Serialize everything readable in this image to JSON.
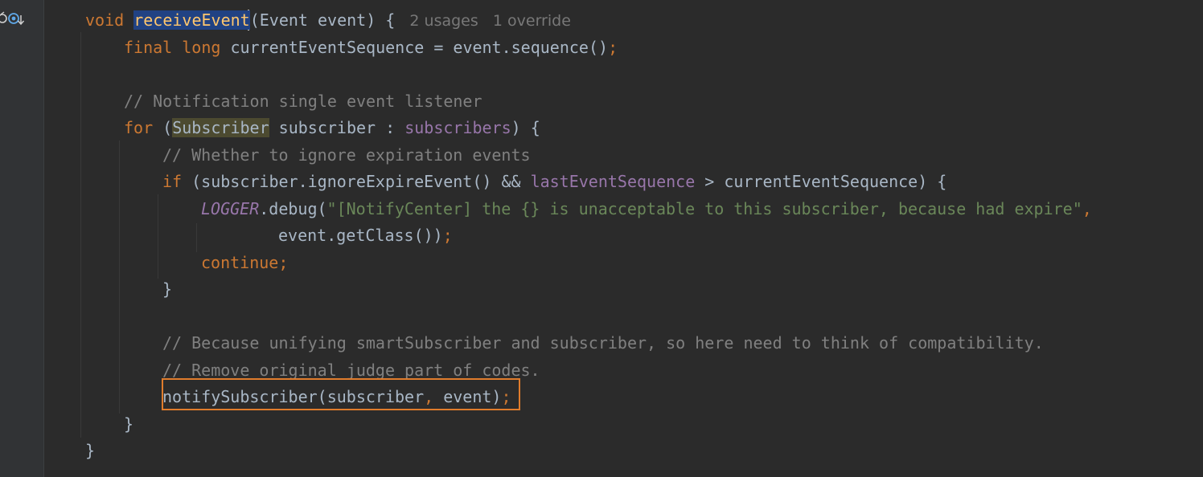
{
  "editor": {
    "gutter_icons": [
      "override-marker-icon",
      "implemented-marker-icon"
    ],
    "colors": {
      "background": "#2b2b2b",
      "keyword": "#cc7832",
      "method": "#ffc66d",
      "comment": "#808080",
      "field": "#9876aa",
      "string": "#6a8759",
      "plain": "#a9b7c6",
      "annotation_box": "#e07c2c"
    },
    "lines": [
      {
        "indent": 1,
        "tokens": [
          {
            "t": "void ",
            "c": "kw"
          },
          {
            "t": "receiveEvent",
            "c": "fn sel"
          },
          {
            "t": "(Event event) { ",
            "c": "pl"
          },
          {
            "t": " 2 usages   1 override",
            "c": "hint"
          }
        ]
      },
      {
        "indent": 2,
        "tokens": [
          {
            "t": "final long ",
            "c": "kw"
          },
          {
            "t": "currentEventSequence = event.sequence()",
            "c": "pl"
          },
          {
            "t": ";",
            "c": "kw"
          }
        ]
      },
      {
        "indent": 2,
        "tokens": []
      },
      {
        "indent": 2,
        "tokens": [
          {
            "t": "// Notification single event listener",
            "c": "cm"
          }
        ]
      },
      {
        "indent": 2,
        "tokens": [
          {
            "t": "for ",
            "c": "kw"
          },
          {
            "t": "(",
            "c": "pl"
          },
          {
            "t": "Subscriber",
            "c": "pl hl"
          },
          {
            "t": " subscriber : ",
            "c": "pl"
          },
          {
            "t": "subscribers",
            "c": "fld"
          },
          {
            "t": ") {",
            "c": "pl"
          }
        ]
      },
      {
        "indent": 3,
        "tokens": [
          {
            "t": "// Whether to ignore expiration events",
            "c": "cm"
          }
        ]
      },
      {
        "indent": 3,
        "tokens": [
          {
            "t": "if ",
            "c": "kw"
          },
          {
            "t": "(subscriber.ignoreExpireEvent() && ",
            "c": "pl"
          },
          {
            "t": "lastEventSequence",
            "c": "fld"
          },
          {
            "t": " > currentEventSequence) {",
            "c": "pl"
          }
        ]
      },
      {
        "indent": 4,
        "tokens": [
          {
            "t": "LOGGER",
            "c": "st"
          },
          {
            "t": ".debug(",
            "c": "pl"
          },
          {
            "t": "\"[NotifyCenter] the {} is unacceptable to this subscriber, because had expire\"",
            "c": "str"
          },
          {
            "t": ",",
            "c": "kw"
          }
        ]
      },
      {
        "indent": 6,
        "tokens": [
          {
            "t": "event.getClass())",
            "c": "pl"
          },
          {
            "t": ";",
            "c": "kw"
          }
        ]
      },
      {
        "indent": 4,
        "tokens": [
          {
            "t": "continue;",
            "c": "kw"
          }
        ]
      },
      {
        "indent": 3,
        "tokens": [
          {
            "t": "}",
            "c": "pl"
          }
        ]
      },
      {
        "indent": 3,
        "tokens": []
      },
      {
        "indent": 3,
        "tokens": [
          {
            "t": "// Because unifying smartSubscriber and subscriber, so here need to think of compatibility.",
            "c": "cm"
          }
        ]
      },
      {
        "indent": 3,
        "tokens": [
          {
            "t": "// Remove original judge part of codes.",
            "c": "cm"
          }
        ]
      },
      {
        "indent": 3,
        "tokens": [
          {
            "t": "notifySubscriber(subscriber",
            "c": "pl"
          },
          {
            "t": ", ",
            "c": "kw"
          },
          {
            "t": "event)",
            "c": "pl"
          },
          {
            "t": ";",
            "c": "kw"
          }
        ]
      },
      {
        "indent": 2,
        "tokens": [
          {
            "t": "}",
            "c": "pl"
          }
        ]
      },
      {
        "indent": 1,
        "tokens": [
          {
            "t": "}",
            "c": "pl"
          }
        ]
      }
    ]
  }
}
